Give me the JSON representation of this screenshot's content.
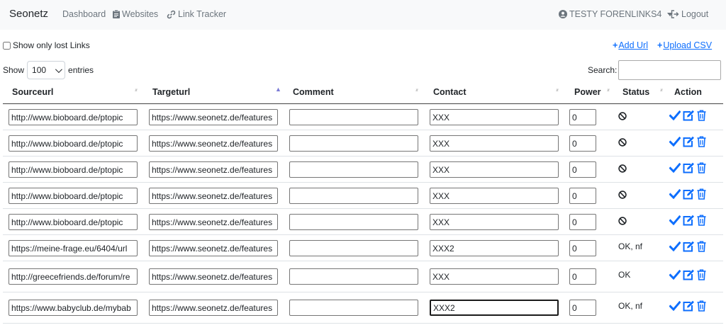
{
  "navbar": {
    "brand": "Seonetz",
    "dashboard": "Dashboard",
    "websites": "Websites",
    "link_tracker": "Link Tracker",
    "user": "TESTY FORENLINKS4",
    "logout": "Logout"
  },
  "controls": {
    "show_lost_label": "Show only lost Links",
    "add_url": "Add Url",
    "upload_csv": "Upload CSV",
    "show_label": "Show",
    "entries_value": "100",
    "entries_label": "entries",
    "search_label": "Search:"
  },
  "table": {
    "columns": [
      "Sourceurl",
      "Targeturl",
      "Comment",
      "Contact",
      "Power",
      "Status",
      "Action"
    ],
    "rows": [
      {
        "source": "http://www.bioboard.de/ptopic",
        "target": "https://www.seonetz.de/features",
        "comment": "",
        "contact": "XXX",
        "power": "0",
        "status": "",
        "status_icon": "ban-icon"
      },
      {
        "source": "http://www.bioboard.de/ptopic",
        "target": "https://www.seonetz.de/features",
        "comment": "",
        "contact": "XXX",
        "power": "0",
        "status": "",
        "status_icon": "ban-icon"
      },
      {
        "source": "http://www.bioboard.de/ptopic",
        "target": "https://www.seonetz.de/features",
        "comment": "",
        "contact": "XXX",
        "power": "0",
        "status": "",
        "status_icon": "ban-icon"
      },
      {
        "source": "http://www.bioboard.de/ptopic",
        "target": "https://www.seonetz.de/features",
        "comment": "",
        "contact": "XXX",
        "power": "0",
        "status": "",
        "status_icon": "ban-icon"
      },
      {
        "source": "http://www.bioboard.de/ptopic",
        "target": "https://www.seonetz.de/features",
        "comment": "",
        "contact": "XXX",
        "power": "0",
        "status": "",
        "status_icon": "ban-icon"
      },
      {
        "source": "https://meine-frage.eu/6404/url",
        "target": "https://www.seonetz.de/features",
        "comment": "",
        "contact": "XXX2",
        "power": "0",
        "status": "OK, nf",
        "status_icon": ""
      },
      {
        "source": "http://greecefriends.de/forum/re",
        "target": "https://www.seonetz.de/features",
        "comment": "",
        "contact": "XXX",
        "power": "0",
        "status": "OK",
        "status_icon": ""
      },
      {
        "source": "https://www.babyclub.de/mybab",
        "target": "https://www.seonetz.de/features",
        "comment": "",
        "contact": "XXX2",
        "power": "0",
        "status": "OK, nf",
        "status_icon": ""
      }
    ]
  },
  "colors": {
    "accent": "#0d6efd",
    "navbar_bg": "#f8f9fa",
    "muted": "#6c757d"
  }
}
